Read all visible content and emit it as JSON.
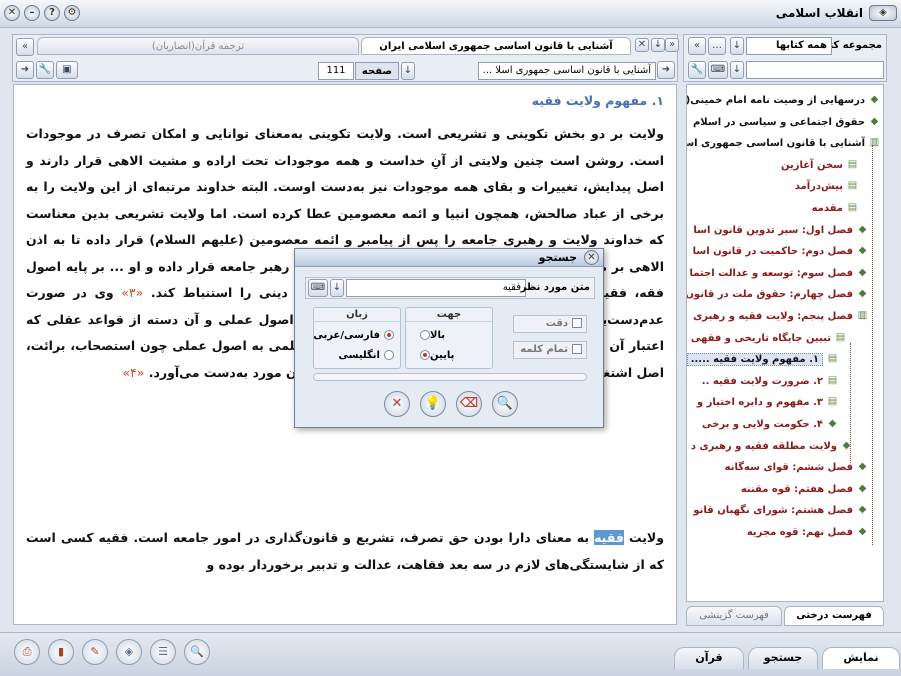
{
  "window": {
    "title": "انقلاب اسلامی"
  },
  "left": {
    "tab_active": "آشنایی با قانون اساسی جمهوری اسلامی ایران",
    "tab_inactive": "ترجمه قرآن(انصاریان)",
    "page_label": "صفحه",
    "page_value": "111",
    "path_value": "آشنایی با قانون اساسی جمهوری اسلا ..."
  },
  "right": {
    "collection_label": "مجموعه کتب",
    "collection_value": "همه کتابها",
    "tab_tree": "فهرست درختی",
    "tab_selective": "فهرست گزینشی"
  },
  "document": {
    "heading": "۱. مفهوم ولایت فقیه",
    "p1_a": "ولایت بر دو بخش تکوینی و تشریعی است. ولایت تکوینی به‌معنای توانایی و امکان تصرف در موجودات است. روشن است چنین ولایتی از آنِ خداست و همه موجودات تحت اراده و مشیت الاهی قرار دارند و اصل پیدایش، تغییرات و بقای همه موجودات نیز به‌دست اوست. البته خداوند مرتبه‌ای از این ولایت را به برخی از عباد صالحش، همچون انبیا و ائمه معصومین عطا کرده است. اما ولایت تشریعی بدین معناست که خداوند ولایت و رهبری جامعه را پس از پیامبر و ائمه معصومین (علیهم السلام) قرار داده تا به اذن الاهی بر مردم حکومت کنند. ... بدین بیان که خداوند فقیه را رهبر جامعه قرار داده و او ... بر پایه اصول فقه، فقیه به کسی گفته می شود که می‌تواند ... احکام دینی را استنباط کند.",
    "r3": "«۳»",
    "p1_b": "وی در صورت عدم‌دست‌یابی به دلیل ... فقاهتی مسئله مورد نظر - یعنی اصول عملی و آن دسته از قواعد عقلی که اعتبار آن ثابت شده است - مراجعه نموده، با داشتن آگاهی علمی به اصول عملی چون استصحاب، برائت، اصل اشتغال و احتیاط و به کار بستن آنها، حکم الاهی را در آن مورد به‌دست می‌آورد.",
    "r4": "«۴»",
    "p2_a": "ولایت",
    "p2_hl": "فقیه",
    "p2_b": "به معنای دارا بودن حق تصرف، تشریع و قانون‌گذاری در امور جامعه است. فقیه کسی است که از شایستگی‌های لازم در سه بعد فقاهت، عدالت و تدبیر برخوردار بوده و"
  },
  "tree": [
    {
      "label": "درسهایی از وصیت نامه امام خمینی(",
      "style": "dark",
      "icon": "book"
    },
    {
      "label": "حقوق اجتماعی و سیاسی در اسلام",
      "style": "dark",
      "icon": "book"
    },
    {
      "label": "آشنایی با قانون اساسی جمهوری اس",
      "style": "dark",
      "icon": "open"
    },
    {
      "label": "سخن آغازین",
      "style": "red",
      "icon": "page"
    },
    {
      "label": "پیش‌درآمد",
      "style": "red",
      "icon": "page"
    },
    {
      "label": "مقدمه",
      "style": "red",
      "icon": "page"
    },
    {
      "label": "فصل اول: سیر تدوین قانون اسا",
      "style": "red",
      "icon": "book"
    },
    {
      "label": "فصل دوم: حاکمیت در قانون اسا",
      "style": "red",
      "icon": "book"
    },
    {
      "label": "فصل سوم: توسعه و عدالت اجتما",
      "style": "red",
      "icon": "book"
    },
    {
      "label": "فصل چهارم: حقوق ملت در قانون",
      "style": "red",
      "icon": "book"
    },
    {
      "label": "فصل پنجم: ولایت فقیه و رهبری",
      "style": "red",
      "icon": "open"
    },
    {
      "label": "تبیین جایگاه تاریخی و فقهی",
      "style": "red",
      "icon": "page"
    },
    {
      "label": "۱. مفهوم ولایت فقیه .....",
      "style": "sel",
      "icon": "page"
    },
    {
      "label": "۲. ضرورت ولایت فقیه ..",
      "style": "red",
      "icon": "page"
    },
    {
      "label": "۳. مفهوم و دایره اختیار و",
      "style": "red",
      "icon": "page"
    },
    {
      "label": "۴. حکومت ولایی و برخی",
      "style": "red",
      "icon": "book"
    },
    {
      "label": "ولایت مطلقه فقیه و رهبری د",
      "style": "red",
      "icon": "book"
    },
    {
      "label": "فصل ششم: قوای سه‌گانه",
      "style": "red",
      "icon": "book"
    },
    {
      "label": "فصل هفتم: قوه مقننه",
      "style": "red",
      "icon": "book"
    },
    {
      "label": "فصل هشتم: شورای نگهبان قانو",
      "style": "red",
      "icon": "book"
    },
    {
      "label": "فصل نهم: قوه مجریه",
      "style": "red",
      "icon": "book"
    }
  ],
  "dialog": {
    "title": "جستجو",
    "target_label": "متن مورد نظر",
    "search_value": "فقیه",
    "direction_title": "جهت",
    "dir_up": "بالا",
    "dir_down": "پایین",
    "language_title": "زبان",
    "lang_fa": "فارسی/عربی",
    "lang_en": "انگلیسی",
    "exact": "دقت",
    "whole_word": "تمام کلمه"
  },
  "bottom_tabs": {
    "display": "نمایش",
    "search": "جستجو",
    "quran": "قرآن"
  },
  "colors": {
    "accent": "#5c98d6",
    "tree_red": "#8b1a1a",
    "ref": "#d04a2a"
  }
}
